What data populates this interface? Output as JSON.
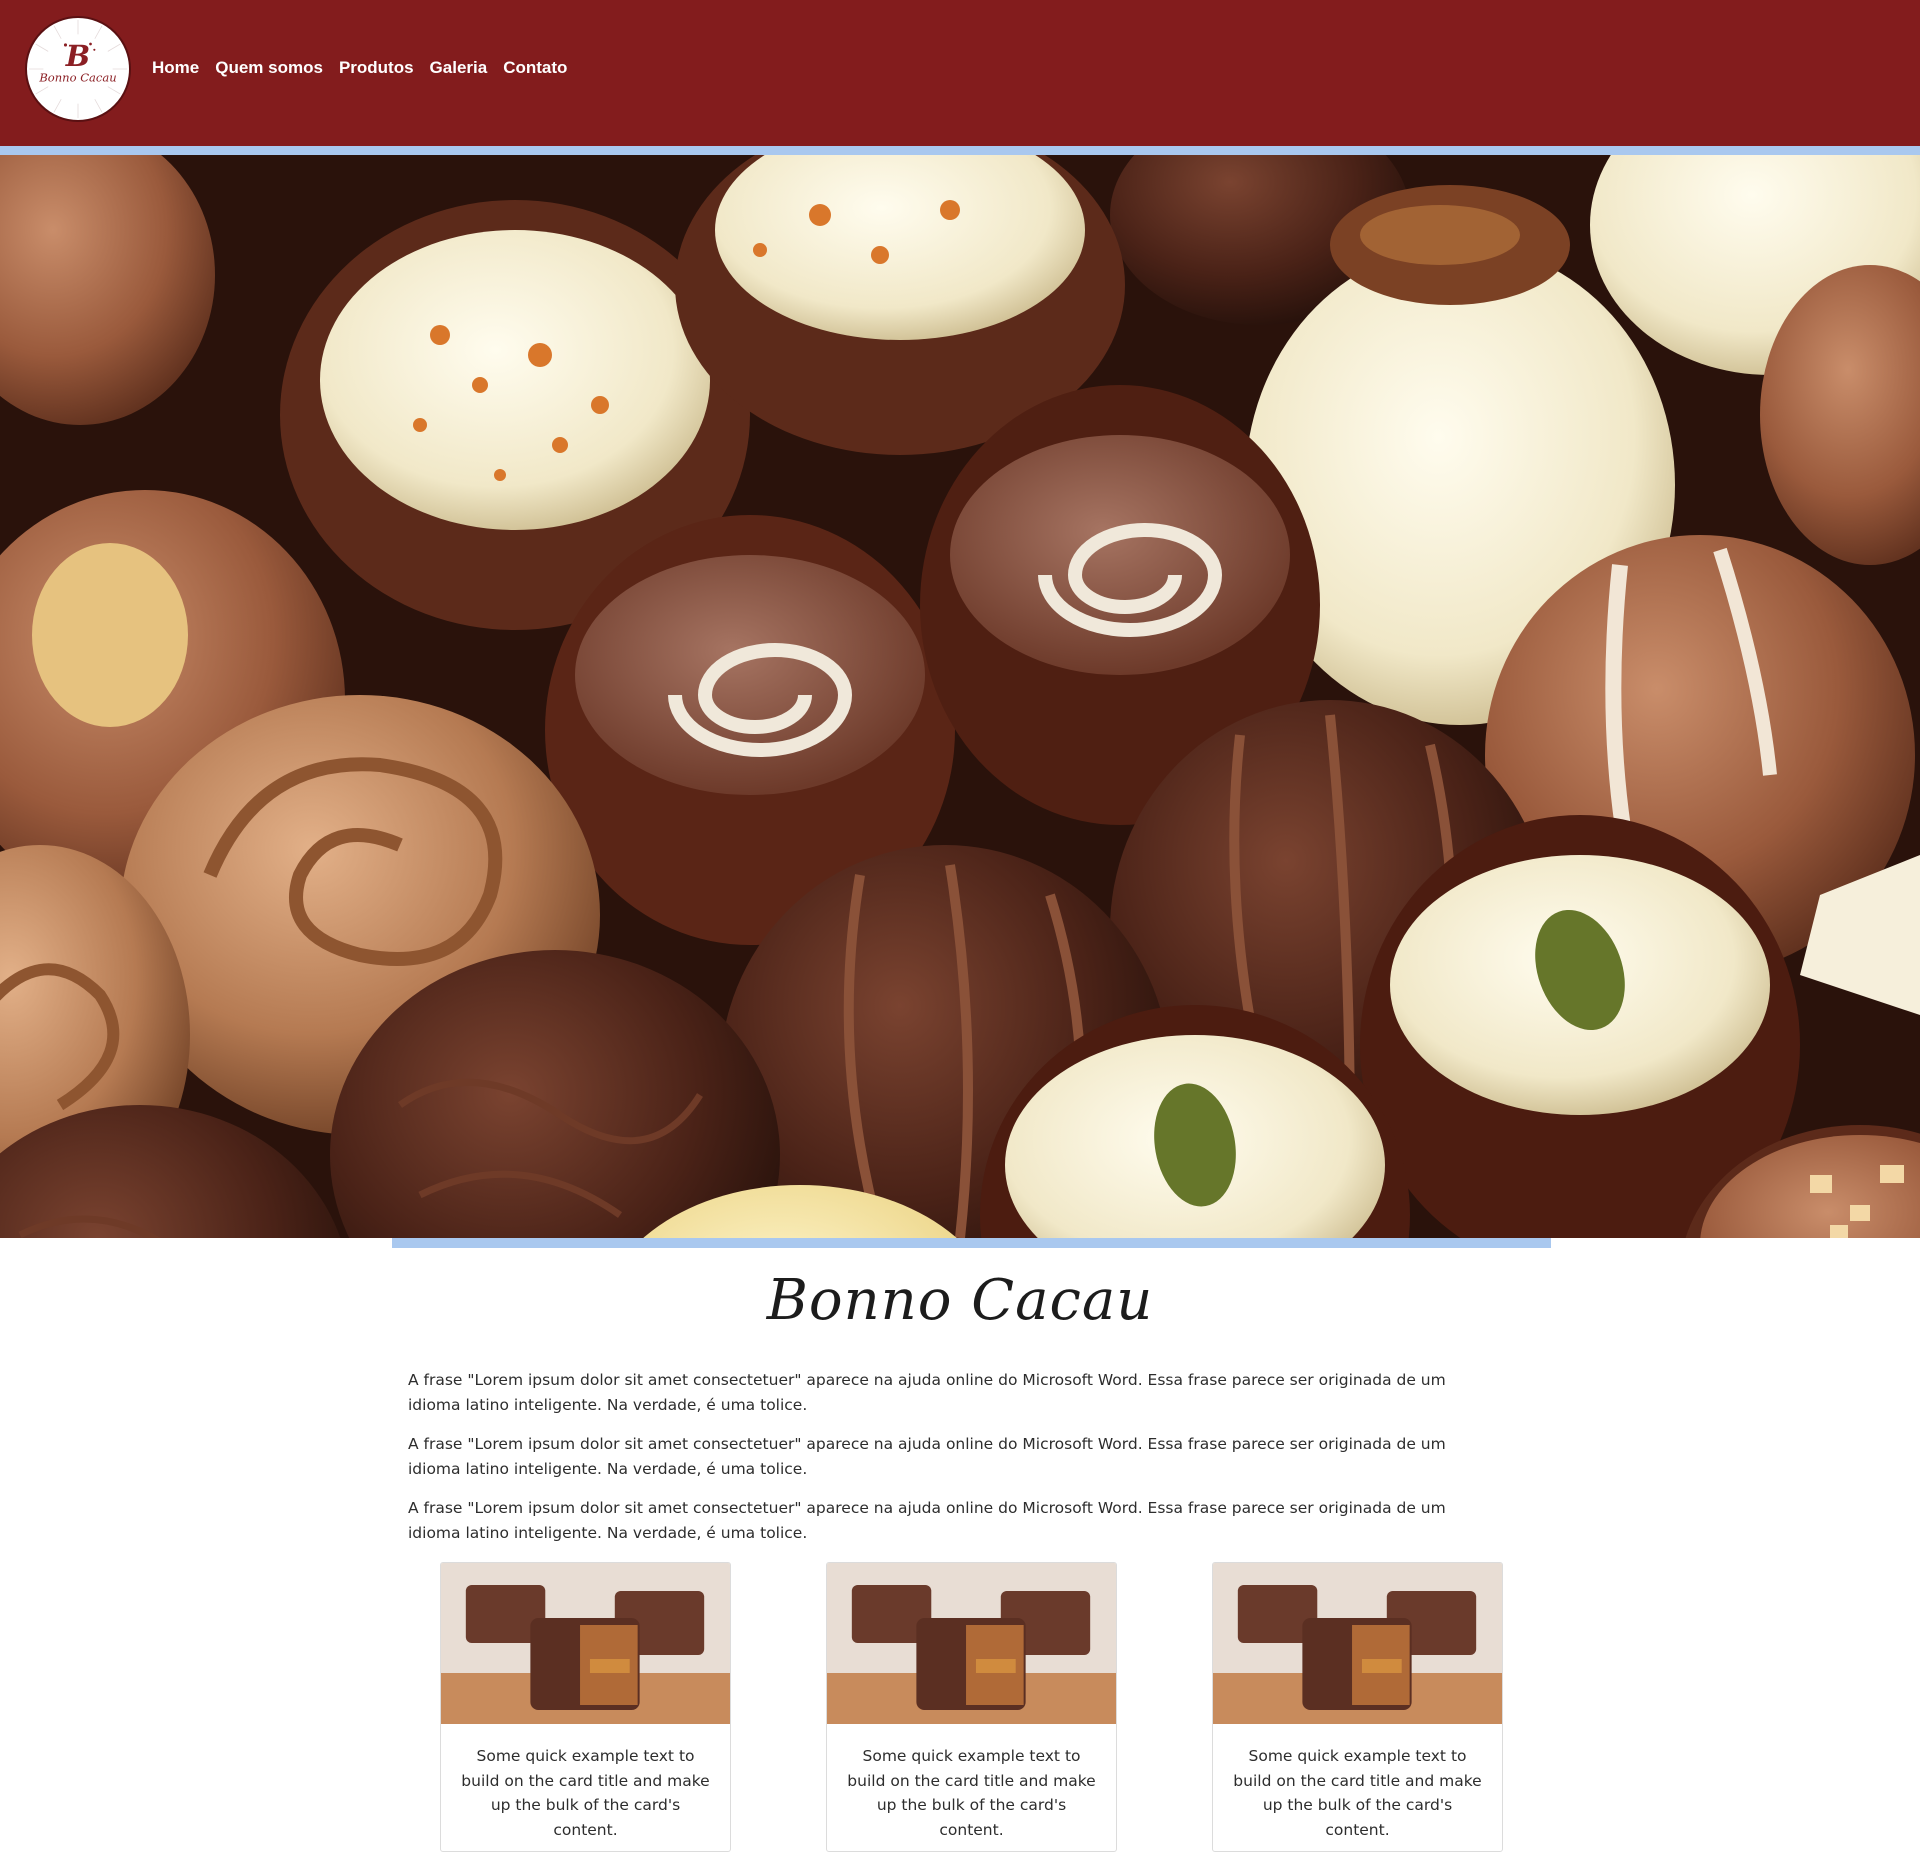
{
  "brand": {
    "logo_text": "Bonno Cacau",
    "logo_letter": "B",
    "name": "Bonno Cacau",
    "colors": {
      "header": "#831c1d",
      "stripe": "#a9c8ef"
    }
  },
  "nav": {
    "items": [
      {
        "label": "Home"
      },
      {
        "label": "Quem somos"
      },
      {
        "label": "Produtos"
      },
      {
        "label": "Galeria"
      },
      {
        "label": "Contato"
      }
    ]
  },
  "hero": {
    "image": "chocolate-bonbons-photo"
  },
  "about": {
    "paragraphs": [
      "A frase \"Lorem ipsum dolor sit amet consectetuer\" aparece na ajuda online do Microsoft Word. Essa frase parece ser originada de um idioma latino inteligente. Na verdade, é uma tolice.",
      "A frase \"Lorem ipsum dolor sit amet consectetuer\" aparece na ajuda online do Microsoft Word. Essa frase parece ser originada de um idioma latino inteligente. Na verdade, é uma tolice.",
      "A frase \"Lorem ipsum dolor sit amet consectetuer\" aparece na ajuda online do Microsoft Word. Essa frase parece ser originada de um idioma latino inteligente. Na verdade, é uma tolice."
    ]
  },
  "cards": [
    {
      "image": "chocolate-cake-bars-photo",
      "text": "Some quick example text to build on the card title and make up the bulk of the card's content."
    },
    {
      "image": "chocolate-cake-bars-photo",
      "text": "Some quick example text to build on the card title and make up the bulk of the card's content."
    },
    {
      "image": "chocolate-cake-bars-photo",
      "text": "Some quick example text to build on the card title and make up the bulk of the card's content."
    }
  ]
}
